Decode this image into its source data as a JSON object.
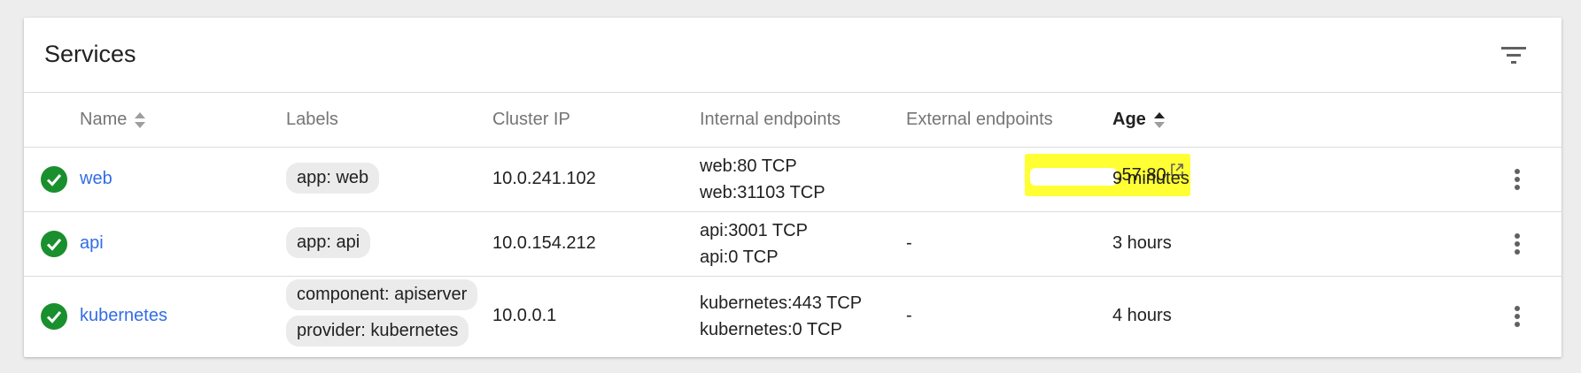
{
  "card": {
    "title": "Services"
  },
  "columns": {
    "name": "Name",
    "labels": "Labels",
    "cluster_ip": "Cluster IP",
    "internal_endpoints": "Internal endpoints",
    "external_endpoints": "External endpoints",
    "age": "Age"
  },
  "rows": [
    {
      "status": "ok",
      "name": "web",
      "labels": [
        "app: web"
      ],
      "cluster_ip": "10.0.241.102",
      "internal": [
        "web:80 TCP",
        "web:31103 TCP"
      ],
      "external": ".57:80",
      "age": "9 minutes"
    },
    {
      "status": "ok",
      "name": "api",
      "labels": [
        "app: api"
      ],
      "cluster_ip": "10.0.154.212",
      "internal": [
        "api:3001 TCP",
        "api:0 TCP"
      ],
      "external": "-",
      "age": "3 hours"
    },
    {
      "status": "ok",
      "name": "kubernetes",
      "labels": [
        "component: apiserver",
        "provider: kubernetes"
      ],
      "cluster_ip": "10.0.0.1",
      "internal": [
        "kubernetes:443 TCP",
        "kubernetes:0 TCP"
      ],
      "external": "-",
      "age": "4 hours"
    }
  ],
  "colors": {
    "status_ok": "#1a8f2e",
    "link": "#326de6",
    "highlight": "#ffff33"
  },
  "icons": {
    "status": "check-circle-icon",
    "filter": "filter-icon",
    "sort": "sort-icon",
    "external_link": "open-in-new-icon",
    "menu": "more-vert-icon"
  }
}
